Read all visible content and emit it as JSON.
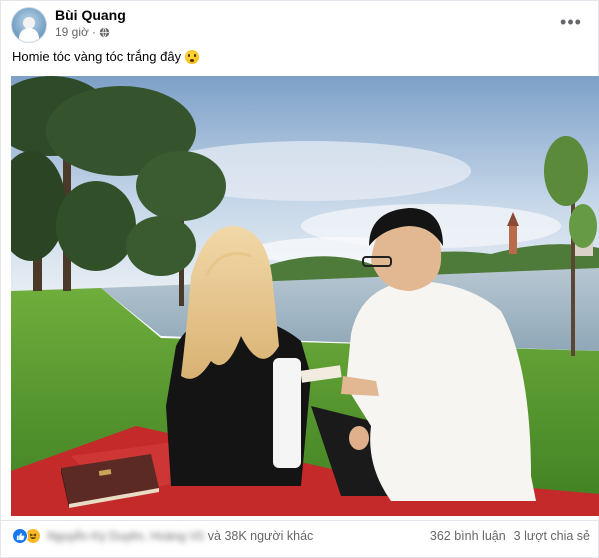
{
  "post": {
    "author": "Bùi Quang",
    "time": "19 giờ",
    "separator": "·",
    "caption": "Homie tóc vàng tóc trắng đây",
    "more_label": "•••"
  },
  "footer": {
    "reaction_names": "Nguyễn Kỳ Duyên, Hoàng Vũ",
    "others_text": "và 38K người khác",
    "comments": "362 bình luận",
    "shares": "3 lượt chia sẻ"
  },
  "icons": {
    "privacy": "globe-icon",
    "menu": "more-options-icon",
    "reactions": [
      "like-icon",
      "haha-icon"
    ],
    "caption_emoji": "surprised-emoji-icon"
  },
  "colors": {
    "like": "#1877f2",
    "haha": "#f7b928",
    "text_secondary": "#65676b",
    "blanket": "#c42a2a"
  }
}
